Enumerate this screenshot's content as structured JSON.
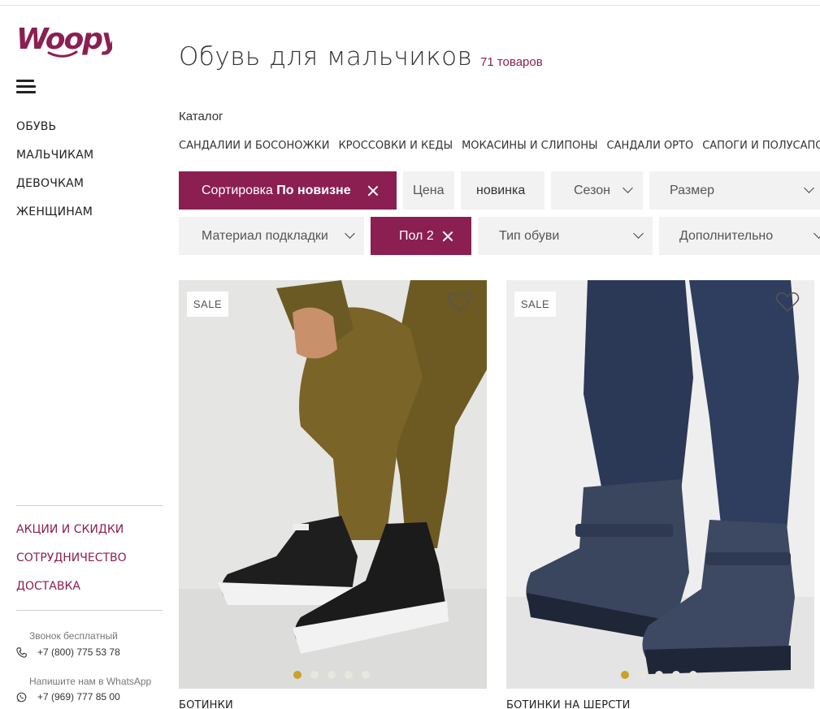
{
  "brand": {
    "logo_text": "Woopy",
    "color": "#8b1f52"
  },
  "sidebar": {
    "menu": [
      "ОБУВЬ",
      "МАЛЬЧИКАМ",
      "ДЕВОЧКАМ",
      "ЖЕНЩИНАМ"
    ],
    "promo_menu": [
      "АКЦИИ И СКИДКИ",
      "СОТРУДНИЧЕСТВО",
      "ДОСТАВКА"
    ],
    "contacts": {
      "phone_label": "Звонок бесплатный",
      "phone": "+7 (800) 775 53 78",
      "whatsapp_label": "Напишите нам в WhatsApp",
      "whatsapp": "+7 (969) 777 85 00"
    }
  },
  "page": {
    "title": "Обувь для мальчиков",
    "count": "71 товаров",
    "catalog_label": "Каталог",
    "categories": [
      "САНДАЛИИ И БОСОНОЖКИ",
      "КРОССОВКИ И КЕДЫ",
      "МОКАСИНЫ И СЛИПОНЫ",
      "САНДАЛИ ОРТО",
      "САПОГИ И ПОЛУСАПОГИ"
    ]
  },
  "filters": {
    "sort_label": "Сортировка",
    "sort_value": "По новизне",
    "price": "Цена",
    "novelty": "новинка",
    "season": "Сезон",
    "size": "Размер",
    "lining": "Материал подкладки",
    "gender": "Пол 2",
    "shoe_type": "Тип обуви",
    "extra": "Дополнительно"
  },
  "products": [
    {
      "badge": "SALE",
      "name": "БОТИНКИ",
      "active_slide": 1,
      "slides": 5
    },
    {
      "badge": "SALE",
      "name": "БОТИНКИ НА ШЕРСТИ",
      "active_slide": 1,
      "slides": 5
    }
  ]
}
